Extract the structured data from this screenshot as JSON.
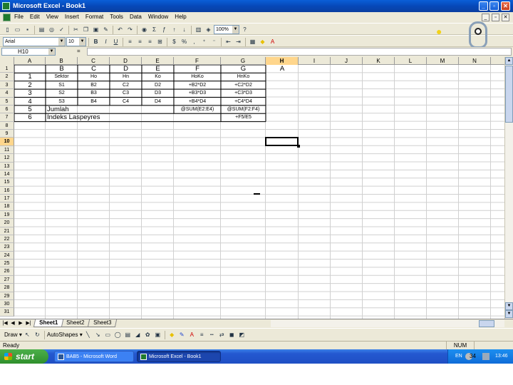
{
  "window": {
    "title": "Microsoft Excel - Book1",
    "minimize": "_",
    "maximize": "▫",
    "close": "✕"
  },
  "menu": {
    "items": [
      "File",
      "Edit",
      "View",
      "Insert",
      "Format",
      "Tools",
      "Data",
      "Window",
      "Help"
    ],
    "mdi_minimize": "_",
    "mdi_restore": "▫",
    "mdi_close": "✕"
  },
  "toolbar_standard": {
    "zoom": "100%"
  },
  "toolbar_format": {
    "font": "Arial",
    "size": "10"
  },
  "formula_bar": {
    "name_box": "H10",
    "fx_label": "=",
    "formula": ""
  },
  "grid": {
    "columns": [
      "A",
      "B",
      "C",
      "D",
      "E",
      "F",
      "G",
      "H",
      "I",
      "J",
      "K",
      "L",
      "M",
      "N"
    ],
    "active_column": "H",
    "rows": [
      "1",
      "2",
      "3",
      "4",
      "5",
      "6",
      "7",
      "8",
      "9",
      "10",
      "11",
      "12",
      "13",
      "14",
      "15",
      "16",
      "17",
      "18",
      "19",
      "20",
      "21",
      "22",
      "23",
      "24",
      "25",
      "26",
      "27",
      "28",
      "29",
      "30",
      "31"
    ],
    "active_row": "10",
    "cells": {
      "B1": "B",
      "C1": "C",
      "D1": "D",
      "E1": "E",
      "F1": "F",
      "G1": "G",
      "H1": "A",
      "A2": "1",
      "B2": "Sektor",
      "C2": "Ho",
      "D2": "Hn",
      "E2": "Ko",
      "F2": "HoKo",
      "G2": "HnKo",
      "A3": "2",
      "B3": "S1",
      "C3": "B2",
      "D3": "C2",
      "E3": "D2",
      "F3": "+B2*D2",
      "G3": "+C2*D2",
      "A4": "3",
      "B4": "S2",
      "C4": "B3",
      "D4": "C3",
      "E4": "D3",
      "F4": "+B3*D3",
      "G4": "+C3*D3",
      "A5": "4",
      "B5": "S3",
      "C5": "B4",
      "D5": "C4",
      "E5": "D4",
      "F5": "+B4*D4",
      "G5": "+C4*D4",
      "A6": "5",
      "B6": "Jumlah",
      "F6": "@SUM(E2:E4)",
      "G6": "@SUM(F2:F4)",
      "A7": "6",
      "B7": "Indeks Laspeyres",
      "G7": "+F5/E5"
    },
    "inner_header_row": [
      "A",
      "B",
      "C",
      "D",
      "E",
      "F"
    ]
  },
  "sheets": {
    "tabs": [
      "Sheet1",
      "Sheet2",
      "Sheet3"
    ],
    "active": "Sheet1"
  },
  "toolbar_drawing": {
    "draw_label": "Draw ▾",
    "autoshapes_label": "AutoShapes ▾"
  },
  "status": {
    "text": "Ready",
    "num": "NUM"
  },
  "taskbar": {
    "start": "start",
    "tasks": [
      "BAB5 - Microsoft Word",
      "Microsoft Excel - Book1"
    ],
    "lang": "EN",
    "page_number": "34",
    "clock": "13:46"
  }
}
